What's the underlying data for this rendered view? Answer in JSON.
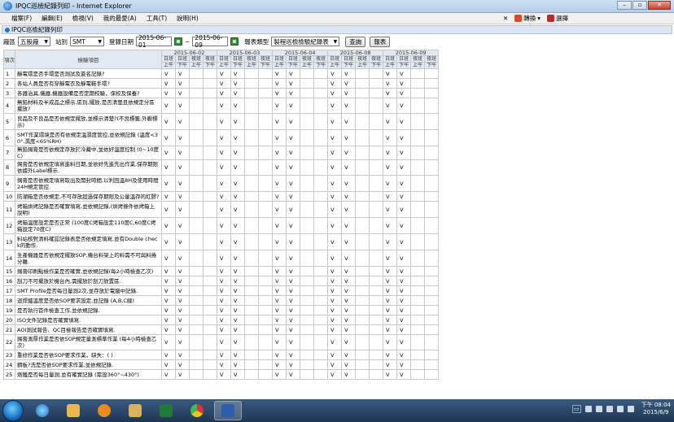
{
  "window": {
    "title": "IPQC巡檢紀錄列印 - Internet Explorer"
  },
  "menu": [
    "檔案(F)",
    "編輯(E)",
    "檢視(V)",
    "我的最愛(A)",
    "工具(T)",
    "說明(H)"
  ],
  "toolbar_right": {
    "convert": "轉換",
    "select": "選擇"
  },
  "section_title": "IPQC巡檢紀錄列印",
  "filters": {
    "area_label": "廠區",
    "area_value": "五股廠",
    "station_label": "站別",
    "station_value": "SMT",
    "date_label": "登錄日期",
    "date_from": "2015-06-01",
    "date_sep": "~",
    "date_to": "2015-06-09",
    "report_label": "報表類型",
    "report_value": "製程巡檢檢驗紀錄表",
    "query_button": "查詢",
    "report_button": "報表"
  },
  "table": {
    "no_header": "項次",
    "item_header": "檢驗項目",
    "dates": [
      "2015-06-02",
      "2015-06-03",
      "2015-06-04",
      "2015-06-08",
      "2015-06-09"
    ],
    "shift_row1": [
      "日班",
      "日班",
      "夜班",
      "夜班"
    ],
    "shift_row2": [
      "上午",
      "下午",
      "上午",
      "下午"
    ],
    "check_mark": "V",
    "check_cols": [
      0,
      1,
      4,
      5,
      8,
      9,
      12,
      13,
      16,
      17
    ],
    "rows": [
      {
        "no": "1",
        "item": "靜電環是否手環是否測試及簽名記錄?"
      },
      {
        "no": "2",
        "item": "各站人員是否有穿靜電衣及靜電鞋手環?"
      },
      {
        "no": "3",
        "item": "各器治具,儀器,機器設備是否定期校驗，保校及保養?"
      },
      {
        "no": "4",
        "item": "無鉛材料及半成品之標示,區別,擺放,是否清楚且依規定分區擺放?"
      },
      {
        "no": "5",
        "item": "良品及不良品是否依規定擺放,並標示清楚?(不良標籤,外觀標示)"
      },
      {
        "no": "6",
        "item": "SMT作業環境是否有依規定溫濕度管控,並依規記錄 (溫度<30°,濕度<65%RH)"
      },
      {
        "no": "7",
        "item": "無鉛錫膏是否依規定存放於冷藏中,並依好溫度控制 (0~10度C)"
      },
      {
        "no": "8",
        "item": "錫膏是否依規定填寫進料日期,並依好先進先出作業,保存期限依據外Label標示."
      },
      {
        "no": "9",
        "item": "錫膏是否依規定填寫取出及開封時間,以利回溫8H及使用時間24H規定管控."
      },
      {
        "no": "10",
        "item": "防潮箱是否依規定,不可存放超過保存期限及公量溫存的紅膠?"
      },
      {
        "no": "11",
        "item": "烤箱烘烤記錄是否確實填寫,並依規記錄,(烘烤條件依烤箱上說明)"
      },
      {
        "no": "12",
        "item": "烤箱溫度設定是否正常 (100度C烤箱設定110度C,60度C烤箱設定70度C)"
      },
      {
        "no": "13",
        "item": "料站核對清料確認記錄表是否依規定填寫,並有Double check的動作."
      },
      {
        "no": "14",
        "item": "生產機器是否依規定擺放SOP,機台料架上的料需不可與料捲分離."
      },
      {
        "no": "15",
        "item": "錫膏印刷點檢作業是否確實,並依規記錄(每2小時檢查乙次)"
      },
      {
        "no": "16",
        "item": "刮刀不可擺放於機台內,需擺放於刮刀放置區."
      },
      {
        "no": "17",
        "item": "SMT Profile是否每日量測2次,並存放於電腦中記錄."
      },
      {
        "no": "18",
        "item": "迴焊爐溫度是否依SOP要求設定,並記錄 (A,B,C線)"
      },
      {
        "no": "19",
        "item": "是否執行首件檢查工作,並依規記錄."
      },
      {
        "no": "20",
        "item": "ISO文件記錄是否確實填寫."
      },
      {
        "no": "21",
        "item": "AOI測試報告、QC目檢報告是否確實填寫."
      },
      {
        "no": "22",
        "item": "錫膏測厚作業是否依SOP規定量測標準作業 (每4小時檢查乙次)"
      },
      {
        "no": "23",
        "item": "重修作業是否依SOP要求作業，缺失：( )"
      },
      {
        "no": "24",
        "item": "鋼板?洗是否依SOP要求作業,並依規記錄."
      },
      {
        "no": "25",
        "item": "烙鐵是否每日量測,並有確實記錄 (需設360°~430°)"
      }
    ]
  },
  "tray": {
    "time": "下午 08:04",
    "date": "2015/6/9"
  },
  "colors": {
    "header_bg": "#e3e9f2",
    "taskbar": "#1d3553",
    "title_grad": "#b4cde8"
  }
}
